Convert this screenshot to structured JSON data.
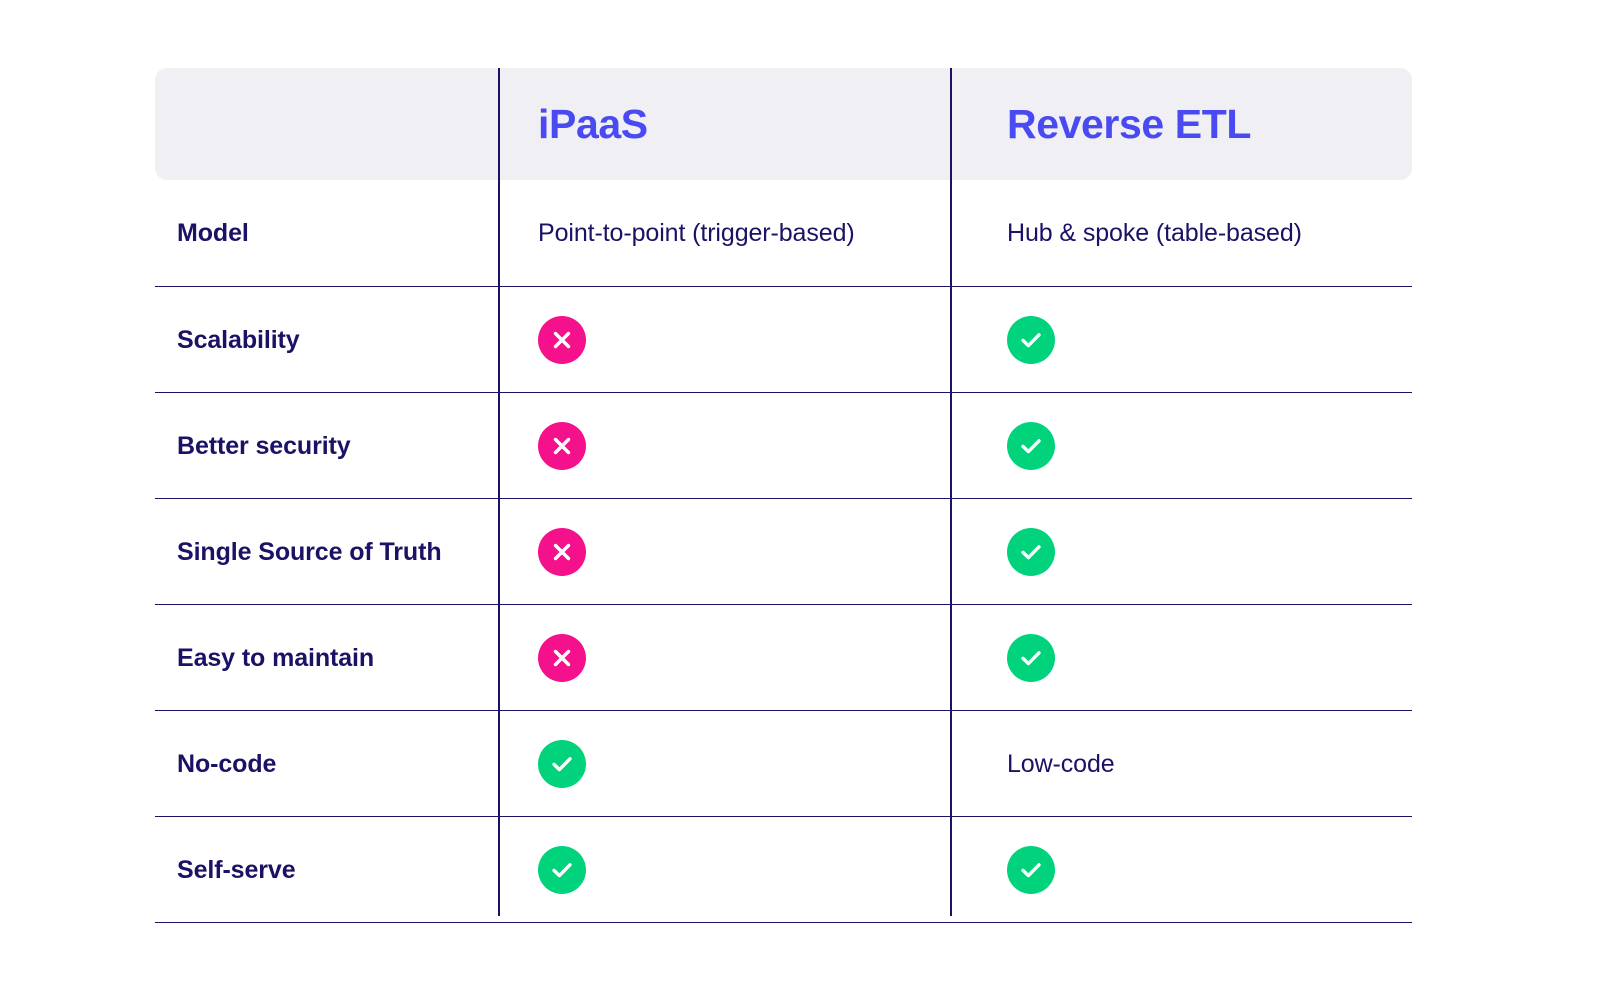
{
  "table": {
    "columns": [
      {
        "key": "feature",
        "label": ""
      },
      {
        "key": "ipaas",
        "label": "iPaaS"
      },
      {
        "key": "reverse_etl",
        "label": "Reverse ETL"
      }
    ],
    "header": {
      "col_a_title": "iPaaS",
      "col_b_title": "Reverse ETL"
    },
    "rows": [
      {
        "label": "Model",
        "ipaas": {
          "type": "text",
          "value": "Point-to-point (trigger-based)"
        },
        "reverse_etl": {
          "type": "text",
          "value": "Hub & spoke (table-based)"
        }
      },
      {
        "label": "Scalability",
        "ipaas": {
          "type": "icon",
          "icon": "cross-circle-icon",
          "value": "No"
        },
        "reverse_etl": {
          "type": "icon",
          "icon": "check-circle-icon",
          "value": "Yes"
        }
      },
      {
        "label": "Better security",
        "ipaas": {
          "type": "icon",
          "icon": "cross-circle-icon",
          "value": "No"
        },
        "reverse_etl": {
          "type": "icon",
          "icon": "check-circle-icon",
          "value": "Yes"
        }
      },
      {
        "label": "Single Source of Truth",
        "ipaas": {
          "type": "icon",
          "icon": "cross-circle-icon",
          "value": "No"
        },
        "reverse_etl": {
          "type": "icon",
          "icon": "check-circle-icon",
          "value": "Yes"
        }
      },
      {
        "label": "Easy to maintain",
        "ipaas": {
          "type": "icon",
          "icon": "cross-circle-icon",
          "value": "No"
        },
        "reverse_etl": {
          "type": "icon",
          "icon": "check-circle-icon",
          "value": "Yes"
        }
      },
      {
        "label": "No-code",
        "ipaas": {
          "type": "icon",
          "icon": "check-circle-icon",
          "value": "Yes"
        },
        "reverse_etl": {
          "type": "text",
          "value": "Low-code"
        }
      },
      {
        "label": "Self-serve",
        "ipaas": {
          "type": "icon",
          "icon": "check-circle-icon",
          "value": "Yes"
        },
        "reverse_etl": {
          "type": "icon",
          "icon": "check-circle-icon",
          "value": "Yes"
        }
      }
    ]
  },
  "colors": {
    "header_background": "#EFEFF4",
    "header_title": "#4A4AF2",
    "text": "#1A1264",
    "rule": "#1A1264",
    "negative": "#F5108C",
    "positive": "#00D37B",
    "page_background": "#FFFFFF"
  }
}
